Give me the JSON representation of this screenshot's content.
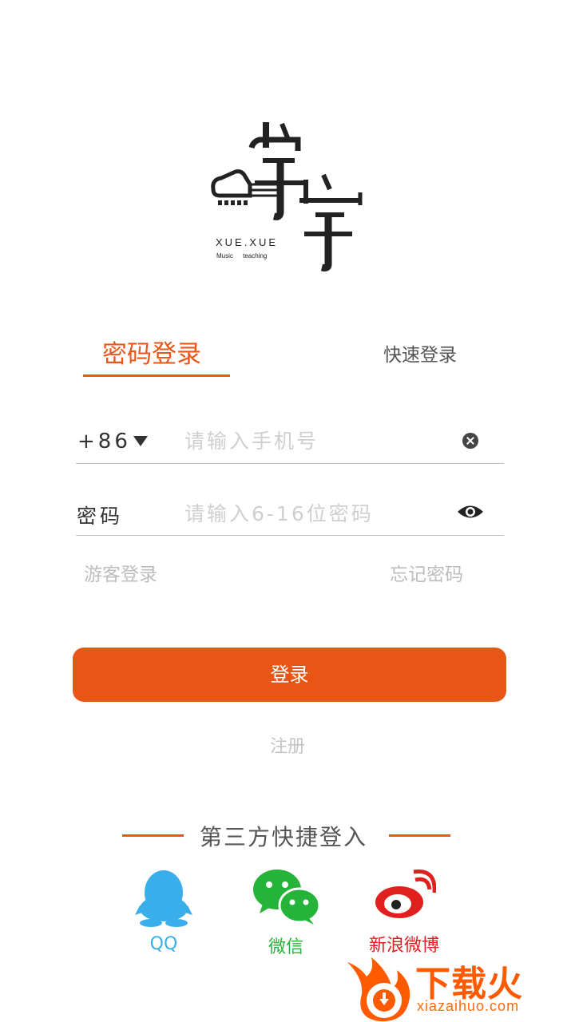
{
  "logo": {
    "title": "XUE.XUE",
    "subtitle": "Music teaching"
  },
  "tabs": {
    "password_login": "密码登录",
    "quick_login": "快速登录"
  },
  "phone": {
    "country_code": "+86",
    "placeholder": "请输入手机号"
  },
  "password": {
    "label": "密码",
    "placeholder": "请输入6-16位密码"
  },
  "links": {
    "guest_login": "游客登录",
    "forgot_password": "忘记密码"
  },
  "login_button": "登录",
  "register": "注册",
  "third_party": {
    "title": "第三方快捷登入",
    "providers": [
      {
        "label": "QQ",
        "icon": "qq-icon"
      },
      {
        "label": "微信",
        "icon": "wechat-icon"
      },
      {
        "label": "新浪微博",
        "icon": "weibo-icon"
      }
    ]
  },
  "watermark": {
    "brand": "下载火",
    "url": "xiazaihuo.com"
  },
  "colors": {
    "accent": "#e85616",
    "qq": "#3aaeea",
    "wechat": "#26b33a",
    "weibo": "#e0201f"
  }
}
